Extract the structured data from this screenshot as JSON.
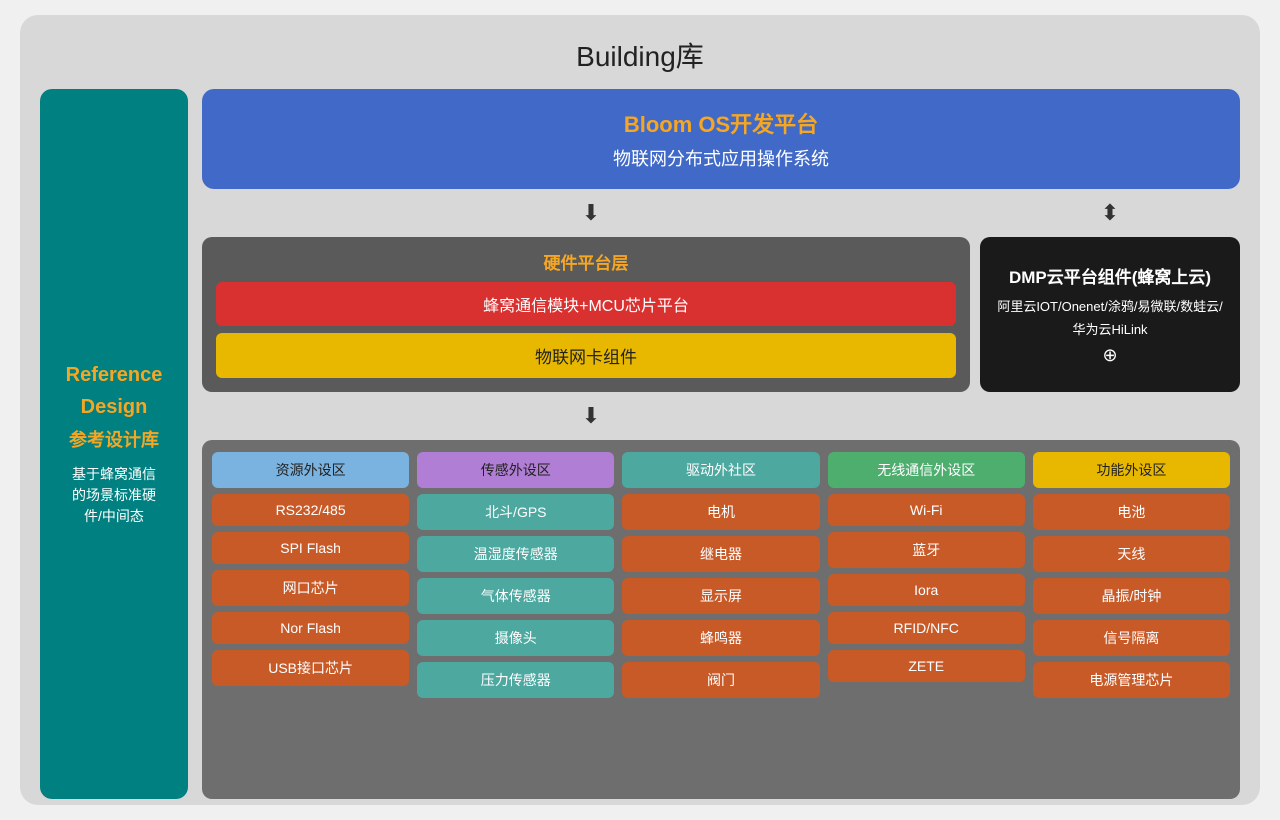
{
  "title": "Building库",
  "sidebar": {
    "ref_line1": "Reference",
    "ref_line2": "Design",
    "cn_title": "参考设计库",
    "desc": "基于蜂窝通信\n的场景标准硬\n件/中间态"
  },
  "os_block": {
    "title_orange": "Bloom OS开发平台",
    "subtitle": "物联网分布式应用操作系统"
  },
  "hardware_block": {
    "title": "硬件平台层",
    "row1": "蜂窝通信模块+MCU芯片平台",
    "row2": "物联网卡组件"
  },
  "dmp_block": {
    "title": "DMP云平台组件(蜂窝上云)",
    "desc": "阿里云IOT/Onenet/涂鸦/易微联/数蛙云/\n华为云HiLink",
    "plus": "⊕"
  },
  "peripheral": {
    "columns": [
      {
        "id": "col1",
        "header": "资源外设区",
        "items": [
          "RS232/485",
          "SPI Flash",
          "网口芯片",
          "Nor Flash",
          "USB接口芯片"
        ]
      },
      {
        "id": "col2",
        "header": "传感外设区",
        "items": [
          "北斗/GPS",
          "温湿度传感器",
          "气体传感器",
          "摄像头",
          "压力传感器"
        ]
      },
      {
        "id": "col3",
        "header": "驱动外社区",
        "items": [
          "电机",
          "继电器",
          "显示屏",
          "蜂鸣器",
          "阀门"
        ]
      },
      {
        "id": "col4",
        "header": "无线通信外设区",
        "items": [
          "Wi-Fi",
          "蓝牙",
          "Iora",
          "RFID/NFC",
          "ZETE"
        ]
      },
      {
        "id": "col5",
        "header": "功能外设区",
        "items": [
          "电池",
          "天线",
          "晶振/时钟",
          "信号隔离",
          "电源管理芯片"
        ]
      }
    ]
  }
}
